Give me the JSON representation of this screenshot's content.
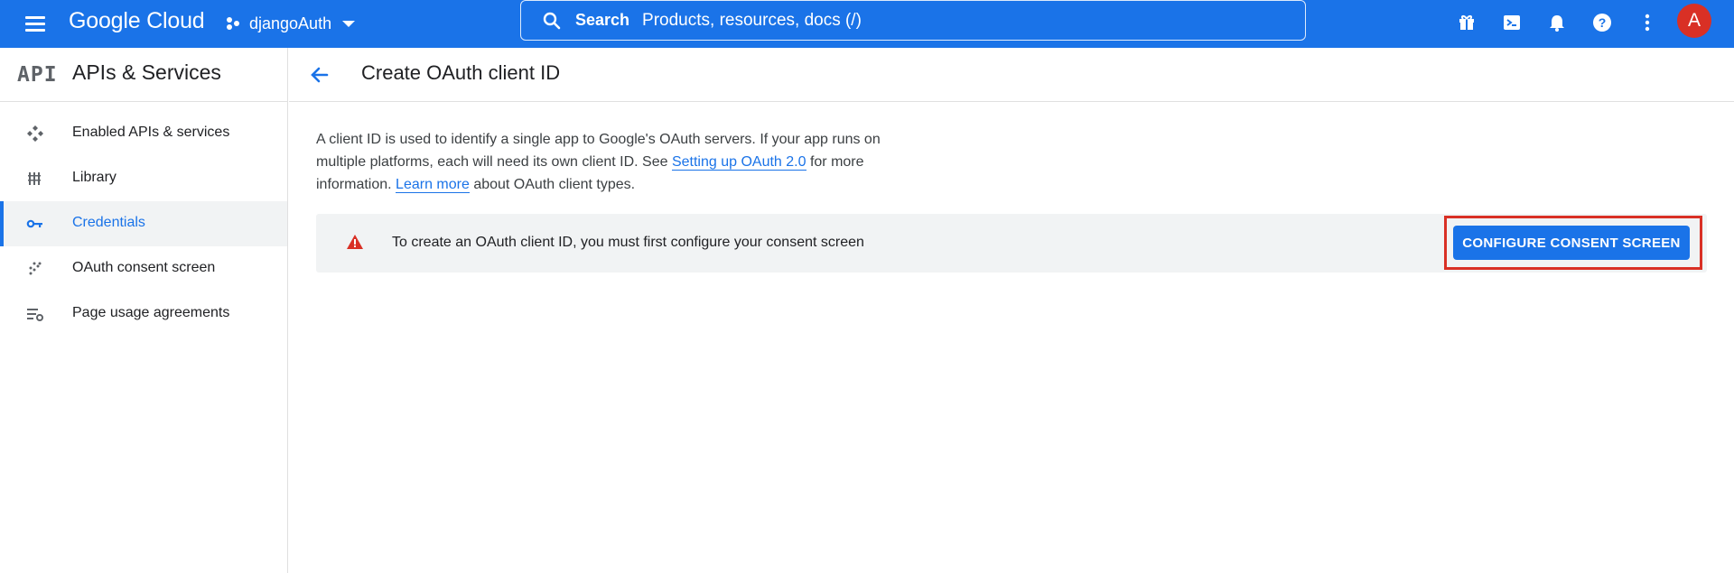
{
  "topbar": {
    "logo": "Google Cloud",
    "project_name": "djangoAuth",
    "search_label": "Search",
    "search_placeholder": "Products, resources, docs (/)",
    "avatar_initial": "A",
    "icons": [
      "menu-icon",
      "gift-icon",
      "terminal-icon",
      "bell-icon",
      "help-icon",
      "more-vert-icon"
    ]
  },
  "sidebar": {
    "logo": "API",
    "title": "APIs & Services",
    "items": [
      {
        "label": "Enabled APIs & services",
        "icon": "apis-icon",
        "active": false
      },
      {
        "label": "Library",
        "icon": "library-icon",
        "active": false
      },
      {
        "label": "Credentials",
        "icon": "key-icon",
        "active": true
      },
      {
        "label": "OAuth consent screen",
        "icon": "consent-icon",
        "active": false
      },
      {
        "label": "Page usage agreements",
        "icon": "settings-list-icon",
        "active": false
      }
    ]
  },
  "page": {
    "title": "Create OAuth client ID",
    "description": {
      "part1": "A client ID is used to identify a single app to Google's OAuth servers. If your app runs on multiple platforms, each will need its own client ID. See ",
      "link1": "Setting up OAuth 2.0",
      "part2": " for more information. ",
      "link2": "Learn more",
      "part3": " about OAuth client types."
    },
    "alert": {
      "message": "To create an OAuth client ID, you must first configure your consent screen",
      "button": "CONFIGURE CONSENT SCREEN"
    }
  },
  "colors": {
    "brand": "#1a73e8",
    "warning": "#d93025",
    "highlight_border": "#d93025"
  }
}
